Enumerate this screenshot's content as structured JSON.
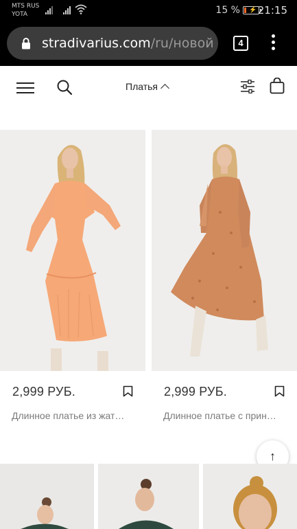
{
  "status_bar": {
    "carrier_line1": "MTS RUS",
    "carrier_line2": "YOTA",
    "battery_percent": "15 %",
    "battery_fill_fraction": 0.15,
    "time": "21:15"
  },
  "browser": {
    "url_host": "stradivarius.com",
    "url_path": "/ru/новой-к",
    "tab_count": "4"
  },
  "header": {
    "category_label": "Платья"
  },
  "products": [
    {
      "price": "2,999 РУБ.",
      "name": "Длинное платье из жат…",
      "dress_color": "#f6a877"
    },
    {
      "price": "2,999 РУБ.",
      "name": "Длинное платье с прин…",
      "dress_color": "#d08a5c"
    }
  ],
  "scroll_top_glyph": "↑",
  "colors": {
    "chrome_bg": "#000000",
    "url_pill": "#3c3c3c",
    "text_primary": "#333333",
    "text_secondary": "#7a7a7a",
    "battery_low": "#ff6a2a"
  }
}
